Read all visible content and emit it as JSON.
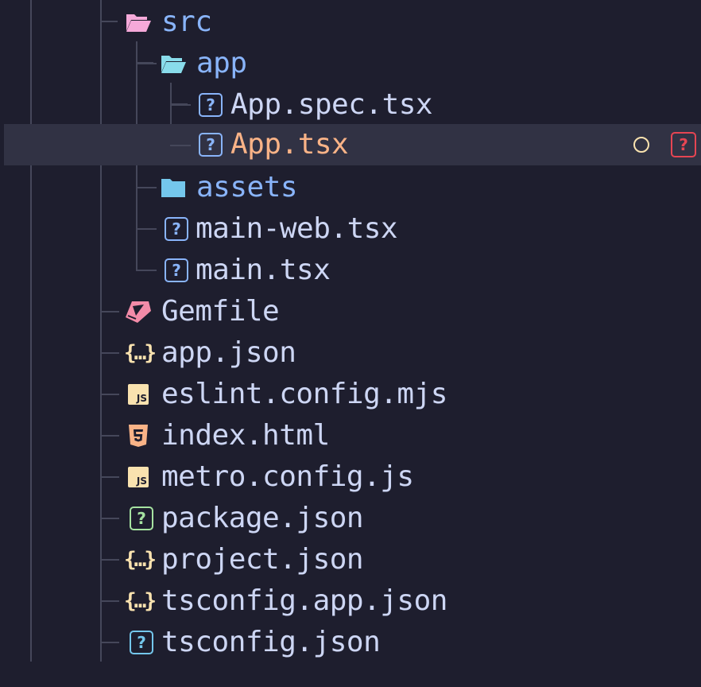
{
  "colors": {
    "background": "#1e1e2e",
    "selected_row": "#313244",
    "guide_line": "#45475a",
    "folder_text": "#89b4fa",
    "file_text": "#cdd6f4",
    "modified_text": "#fab387",
    "src_folder_icon": "#f5a9d9",
    "app_folder_icon": "#89dceb",
    "assets_folder_icon": "#74c7ec",
    "gemfile_icon": "#f38ba8",
    "json_icon": "#f9e2af",
    "js_icon": "#f9e2af",
    "html_icon": "#fab387",
    "unknown_icon_blue": "#89b4fa",
    "unknown_icon_green": "#a6e3a1",
    "unknown_icon_teal": "#74c7ec",
    "status_modified": "#f9e2af",
    "status_error": "#e64553"
  },
  "tree": {
    "src": {
      "label": "src",
      "icon": "folder-open-icon"
    },
    "app": {
      "label": "app",
      "icon": "folder-open-icon"
    },
    "app_spec": {
      "label": "App.spec.tsx",
      "icon": "unknown-file-icon"
    },
    "app_tsx": {
      "label": "App.tsx",
      "icon": "unknown-file-icon",
      "status_error_glyph": "?"
    },
    "assets": {
      "label": "assets",
      "icon": "folder-icon"
    },
    "main_web": {
      "label": "main-web.tsx",
      "icon": "unknown-file-icon"
    },
    "main": {
      "label": "main.tsx",
      "icon": "unknown-file-icon"
    },
    "gemfile": {
      "label": "Gemfile",
      "icon": "ruby-icon"
    },
    "app_json": {
      "label": "app.json",
      "icon": "json-braces-icon"
    },
    "eslint": {
      "label": "eslint.config.mjs",
      "icon": "javascript-icon"
    },
    "index_html": {
      "label": "index.html",
      "icon": "html5-icon"
    },
    "metro": {
      "label": "metro.config.js",
      "icon": "javascript-icon"
    },
    "package_json": {
      "label": "package.json",
      "icon": "unknown-file-icon"
    },
    "project_json": {
      "label": "project.json",
      "icon": "json-braces-icon"
    },
    "tsconfig_app": {
      "label": "tsconfig.app.json",
      "icon": "json-braces-icon"
    },
    "tsconfig": {
      "label": "tsconfig.json",
      "icon": "unknown-file-icon"
    }
  },
  "glyphs": {
    "question": "?",
    "braces": "{…}",
    "js": "JS"
  }
}
